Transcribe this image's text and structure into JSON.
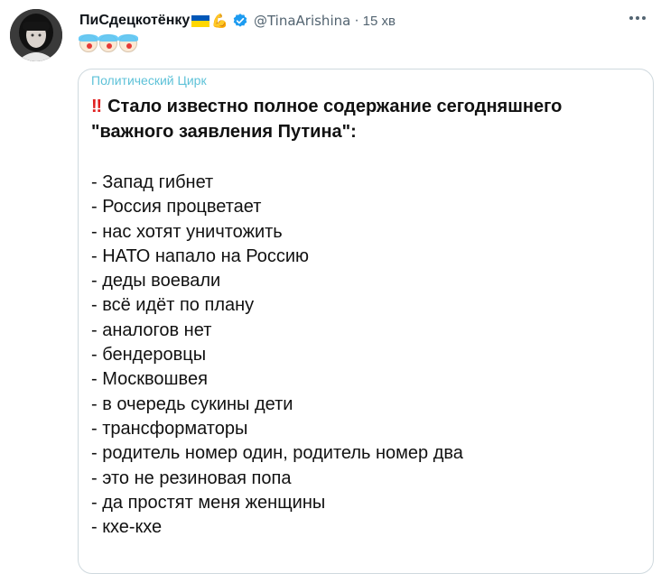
{
  "author": {
    "display_name": "ПиСдецкотёнку",
    "handle": "@TinaArishina",
    "separator": "·",
    "time": "15 хв",
    "avatar_icon": "avatar-photo",
    "flag_colors": [
      "#0057b7",
      "#ffd700"
    ],
    "verified_color": "#1d9bf0"
  },
  "tweet": {
    "emoji_icons": [
      "clown-face-icon",
      "clown-face-icon",
      "clown-face-icon"
    ]
  },
  "card": {
    "source": "Политический Цирк",
    "headline_marker": "‼",
    "headline": "Стало известно полное содержание сегодняшнего \"важного заявления Путина\":",
    "items": [
      "- Запад гибнет",
      "- Россия процветает",
      "- нас хотят уничтожить",
      "- НАТО напало на Россию",
      "- деды воевали",
      "- всё идёт по плану",
      "- аналогов нет",
      "- бендеровцы",
      "- Москвошвея",
      "- в очередь сукины дети",
      "- трансформаторы",
      "- родитель номер один, родитель номер два",
      "- это не резиновая попа",
      "- да простят меня женщины",
      "- кхе-кхе"
    ]
  }
}
